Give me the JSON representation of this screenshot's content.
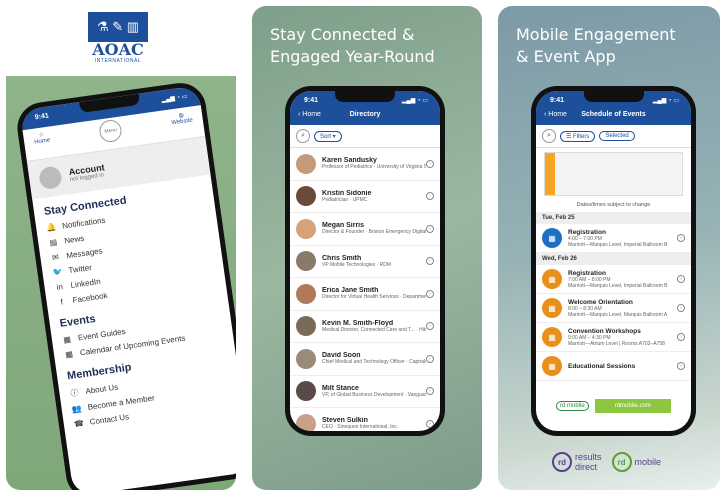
{
  "panel1": {
    "logo_text": "AOAC",
    "logo_sub": "INTERNATIONAL",
    "phone": {
      "time": "9:41",
      "tabs": {
        "home": "Home",
        "menu": "Menu",
        "website": "Website"
      },
      "account": {
        "title": "Account",
        "status": "not logged in"
      },
      "sections": [
        {
          "title": "Stay Connected",
          "items": [
            {
              "label": "Notifications",
              "icon": "bell-icon",
              "glyph": "🔔"
            },
            {
              "label": "News",
              "icon": "news-icon",
              "glyph": "▤"
            },
            {
              "label": "Messages",
              "icon": "messages-icon",
              "glyph": "✉"
            },
            {
              "label": "Twitter",
              "icon": "twitter-icon",
              "glyph": "🐦"
            },
            {
              "label": "LinkedIn",
              "icon": "linkedin-icon",
              "glyph": "in"
            },
            {
              "label": "Facebook",
              "icon": "facebook-icon",
              "glyph": "f"
            }
          ]
        },
        {
          "title": "Events",
          "items": [
            {
              "label": "Event Guides",
              "icon": "guide-icon",
              "glyph": "▦"
            },
            {
              "label": "Calendar of Upcoming Events",
              "icon": "calendar-icon",
              "glyph": "▦"
            }
          ]
        },
        {
          "title": "Membership",
          "items": [
            {
              "label": "About Us",
              "icon": "info-icon",
              "glyph": "ⓘ"
            },
            {
              "label": "Become a Member",
              "icon": "people-icon",
              "glyph": "👥"
            },
            {
              "label": "Contact Us",
              "icon": "phone-icon",
              "glyph": "☎"
            }
          ]
        }
      ]
    }
  },
  "panel2": {
    "headline_line1": "Stay Connected &",
    "headline_line2": "Engaged Year-Round",
    "phone": {
      "time": "9:41",
      "back": "Home",
      "title": "Directory",
      "sort_label": "Sort",
      "people": [
        {
          "name": "Karen Sandusky",
          "desc": "Professor of Pediatrics · University of Virginia School of Medicine",
          "color": "#c49a7a"
        },
        {
          "name": "Kristin Sidonie",
          "desc": "Pediatrician · UPMC",
          "color": "#6b4a3a"
        },
        {
          "name": "Megan Sirris",
          "desc": "Director & Founder · Boston Emergency Digital Health Innovati...",
          "color": "#d6a27a"
        },
        {
          "name": "Chris Smith",
          "desc": "VP Mobile Technologies · RDM",
          "color": "#8a7a6a"
        },
        {
          "name": "Erica Jane Smith",
          "desc": "Director for Virtual Health Services · Department of Emergency Medicine at...",
          "color": "#b07a5a"
        },
        {
          "name": "Kevin M. Smith-Floyd",
          "desc": "Medical Director, Connected Care and T... · Hitchcock Health",
          "color": "#7a6a5a"
        },
        {
          "name": "David Soon",
          "desc": "Chief Medical and Technology Officer · Captrald",
          "color": "#9a8a7a"
        },
        {
          "name": "Milt Stance",
          "desc": "VP, of Global Business Development · Vanguard Integrity Professionals",
          "color": "#5a4a4a"
        },
        {
          "name": "Steven Sulkin",
          "desc": "CEO · Sinequon International, Inc.",
          "color": "#caa08a"
        }
      ]
    }
  },
  "panel3": {
    "headline_line1": "Mobile Engagement",
    "headline_line2": "& Event App",
    "phone": {
      "time": "9:41",
      "back": "Home",
      "title": "Schedule of Events",
      "filters_label": "Filters",
      "selected_label": "Selected",
      "note": "Dates/times subject to change",
      "days": [
        {
          "label": "Tue, Feb 25",
          "events": [
            {
              "name": "Registration",
              "time": "4:00 – 7:00 PM",
              "place": "Marriott—Marquis Level, Imperial Ballroom B",
              "color": "#1d6fc4"
            }
          ]
        },
        {
          "label": "Wed, Feb 26",
          "events": [
            {
              "name": "Registration",
              "time": "7:00 AM – 8:00 PM",
              "place": "Marriott—Marquis Level, Imperial Ballroom B",
              "color": "#e8901a"
            },
            {
              "name": "Welcome Orientation",
              "time": "8:00 – 8:30 AM",
              "place": "Marriott—Marquis Level, Marquis Ballroom A",
              "color": "#e8901a"
            },
            {
              "name": "Convention Workshops",
              "time": "9:00 AM – 4:30 PM",
              "place": "Marriott—Atrium Level | Rooms A703–A758",
              "color": "#e8901a"
            },
            {
              "name": "Educational Sessions",
              "time": "",
              "place": "",
              "color": "#e8901a"
            }
          ]
        }
      ],
      "footer_logo": "rd mobile",
      "footer_url": "rdmobile.com"
    },
    "brand1_line1": "results",
    "brand1_line2": "direct",
    "brand2": "mobile"
  }
}
